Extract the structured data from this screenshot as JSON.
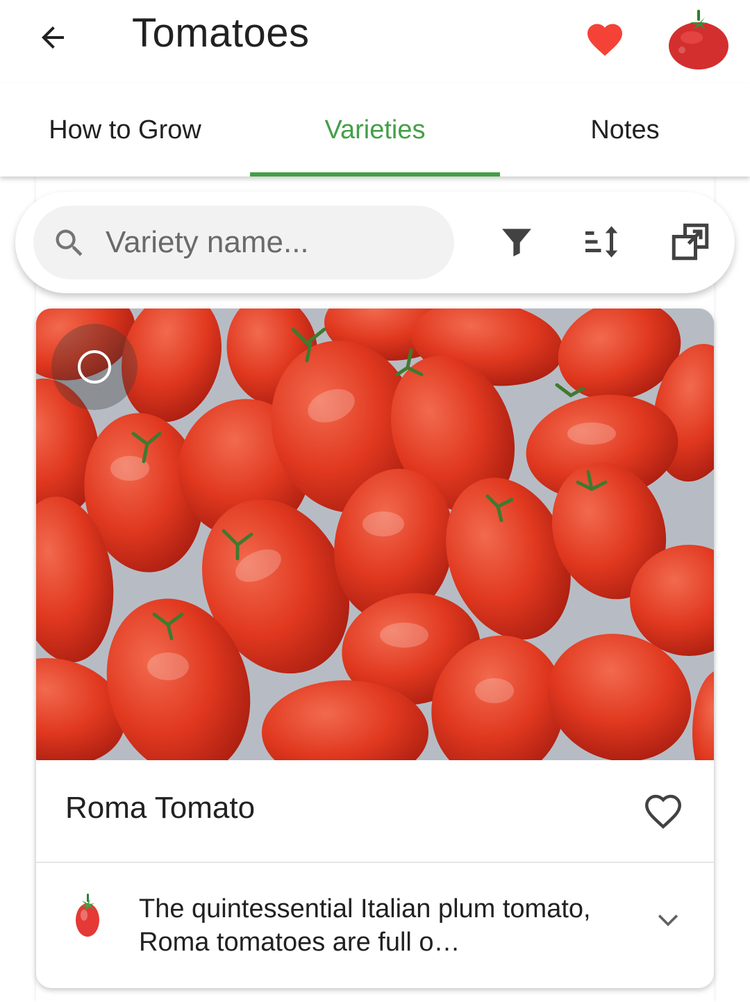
{
  "app_bar": {
    "title": "Tomatoes",
    "back_icon": "arrow-back-icon",
    "favorite_icon": "heart-filled-icon",
    "avatar_icon": "tomato-icon",
    "favorite_color": "#f44336"
  },
  "tabs": [
    {
      "label": "How to Grow",
      "active": false
    },
    {
      "label": "Varieties",
      "active": true
    },
    {
      "label": "Notes",
      "active": false
    }
  ],
  "accent_color": "#43a047",
  "search": {
    "placeholder": "Variety name...",
    "value": "",
    "tools": [
      "filter-icon",
      "sort-icon",
      "compare-icon"
    ]
  },
  "varieties": [
    {
      "name": "Roma Tomato",
      "description": "The quintessential Italian plum tomato, Roma tomatoes are full o…",
      "favorite": false,
      "selected": false,
      "photo": "roma-tomatoes-photo"
    }
  ]
}
